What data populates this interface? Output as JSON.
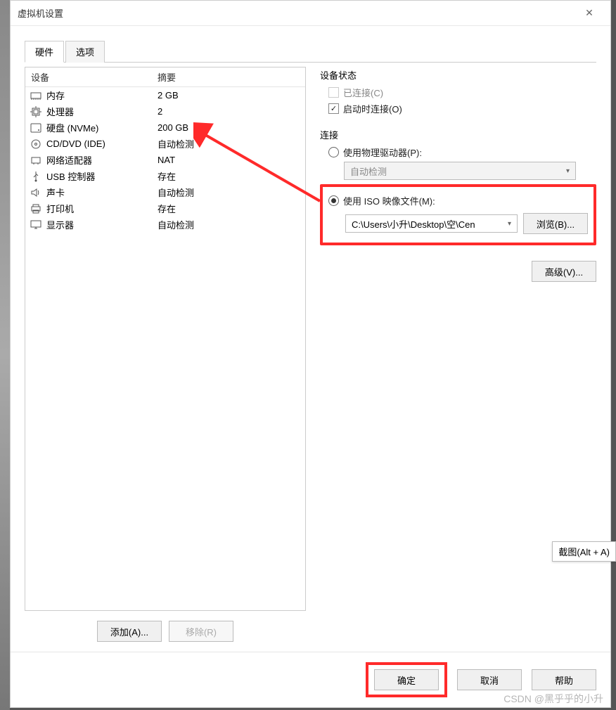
{
  "window": {
    "title": "虚拟机设置"
  },
  "tabs": {
    "hardware": "硬件",
    "options": "选项"
  },
  "deviceList": {
    "headers": {
      "device": "设备",
      "summary": "摘要"
    },
    "rows": [
      {
        "icon": "memory-icon",
        "name": "内存",
        "summary": "2 GB"
      },
      {
        "icon": "cpu-icon",
        "name": "处理器",
        "summary": "2"
      },
      {
        "icon": "disk-icon",
        "name": "硬盘 (NVMe)",
        "summary": "200 GB"
      },
      {
        "icon": "disc-icon",
        "name": "CD/DVD (IDE)",
        "summary": "自动检测"
      },
      {
        "icon": "network-icon",
        "name": "网络适配器",
        "summary": "NAT"
      },
      {
        "icon": "usb-icon",
        "name": "USB 控制器",
        "summary": "存在"
      },
      {
        "icon": "sound-icon",
        "name": "声卡",
        "summary": "自动检测"
      },
      {
        "icon": "printer-icon",
        "name": "打印机",
        "summary": "存在"
      },
      {
        "icon": "monitor-icon",
        "name": "显示器",
        "summary": "自动检测"
      }
    ]
  },
  "buttons": {
    "add": "添加(A)...",
    "remove": "移除(R)"
  },
  "right": {
    "deviceStatus": {
      "title": "设备状态",
      "connected": "已连接(C)",
      "connectAtPowerOn": "启动时连接(O)"
    },
    "connection": {
      "title": "连接",
      "usePhysical": "使用物理驱动器(P):",
      "autoDetect": "自动检测",
      "useIso": "使用 ISO 映像文件(M):",
      "isoPath": "C:\\Users\\小升\\Desktop\\空\\Cen",
      "browse": "浏览(B)..."
    },
    "advanced": "高级(V)..."
  },
  "footer": {
    "ok": "确定",
    "cancel": "取消",
    "help": "帮助"
  },
  "tooltip": "截图(Alt + A)",
  "watermark": "CSDN @黑乎乎的小升"
}
